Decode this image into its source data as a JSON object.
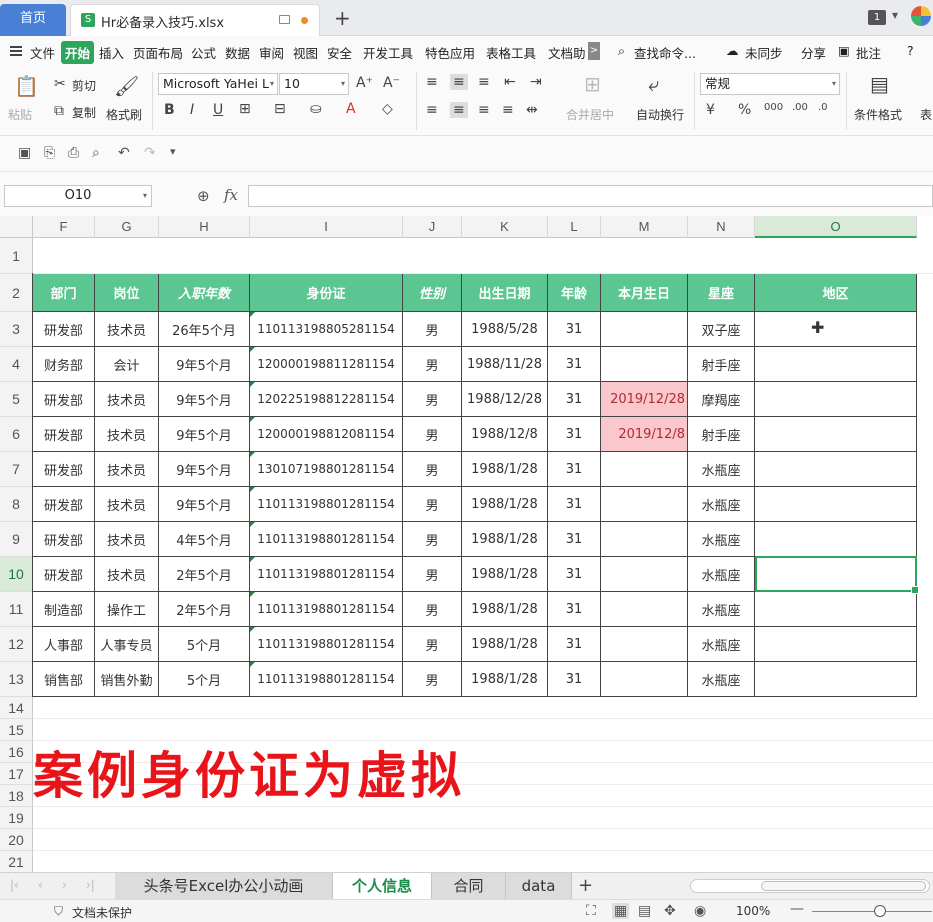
{
  "tabs": {
    "home": "首页",
    "file_badge": "S",
    "file_name": "Hr必备录入技巧.xlsx",
    "window_count": "1"
  },
  "menu": {
    "items": [
      "文件",
      "开始",
      "插入",
      "页面布局",
      "公式",
      "数据",
      "审阅",
      "视图",
      "安全",
      "开发工具",
      "特色应用",
      "表格工具",
      "文档助"
    ],
    "more": ">",
    "search": "查找命令...",
    "sync": "未同步",
    "share": "分享",
    "comment": "批注",
    "help": "?"
  },
  "ribbon": {
    "paste": "粘贴",
    "cut": "剪切",
    "copy": "复制",
    "format_painter": "格式刷",
    "font_name": "Microsoft YaHei L",
    "font_size": "10",
    "merge_center": "合并居中",
    "wrap_text": "自动换行",
    "number_format": "常规",
    "conditional_format": "条件格式",
    "table_style": "表"
  },
  "formula_bar": {
    "name_box": "O10",
    "fx": "fx",
    "content": ""
  },
  "grid": {
    "columns": [
      "F",
      "G",
      "H",
      "I",
      "J",
      "K",
      "L",
      "M",
      "N",
      "O"
    ],
    "selected_column": "O",
    "rows": [
      "1",
      "2",
      "3",
      "4",
      "5",
      "6",
      "7",
      "8",
      "9",
      "10",
      "11",
      "12",
      "13",
      "14",
      "15",
      "16",
      "17",
      "18",
      "19",
      "20",
      "21"
    ],
    "selected_row": "10",
    "header": [
      "部门",
      "岗位",
      "入职年数",
      "身份证",
      "性别",
      "出生日期",
      "年龄",
      "本月生日",
      "星座",
      "地区"
    ],
    "data": [
      [
        "研发部",
        "技术员",
        "26年5个月",
        "110113198805281154",
        "男",
        "1988/5/28",
        "31",
        "",
        "双子座",
        ""
      ],
      [
        "财务部",
        "会计",
        "9年5个月",
        "120000198811281154",
        "男",
        "1988/11/28",
        "31",
        "",
        "射手座",
        ""
      ],
      [
        "研发部",
        "技术员",
        "9年5个月",
        "120225198812281154",
        "男",
        "1988/12/28",
        "31",
        "2019/12/28",
        "摩羯座",
        ""
      ],
      [
        "研发部",
        "技术员",
        "9年5个月",
        "120000198812081154",
        "男",
        "1988/12/8",
        "31",
        "2019/12/8",
        "射手座",
        ""
      ],
      [
        "研发部",
        "技术员",
        "9年5个月",
        "130107198801281154",
        "男",
        "1988/1/28",
        "31",
        "",
        "水瓶座",
        ""
      ],
      [
        "研发部",
        "技术员",
        "9年5个月",
        "110113198801281154",
        "男",
        "1988/1/28",
        "31",
        "",
        "水瓶座",
        ""
      ],
      [
        "研发部",
        "技术员",
        "4年5个月",
        "110113198801281154",
        "男",
        "1988/1/28",
        "31",
        "",
        "水瓶座",
        ""
      ],
      [
        "研发部",
        "技术员",
        "2年5个月",
        "110113198801281154",
        "男",
        "1988/1/28",
        "31",
        "",
        "水瓶座",
        ""
      ],
      [
        "制造部",
        "操作工",
        "2年5个月",
        "110113198801281154",
        "男",
        "1988/1/28",
        "31",
        "",
        "水瓶座",
        ""
      ],
      [
        "人事部",
        "人事专员",
        "5个月",
        "110113198801281154",
        "男",
        "1988/1/28",
        "31",
        "",
        "水瓶座",
        ""
      ],
      [
        "销售部",
        "销售外勤",
        "5个月",
        "110113198801281154",
        "男",
        "1988/1/28",
        "31",
        "",
        "水瓶座",
        ""
      ]
    ],
    "banner": "案例身份证为虚拟",
    "colors": {
      "header_bg": "#5cc692",
      "highlight_bg": "#f9c7cc",
      "highlight_text": "#b22a35",
      "banner": "#e8141a",
      "accent": "#2da55c"
    }
  },
  "sheets": {
    "tabs": [
      "头条号Excel办公小动画",
      "个人信息",
      "合同",
      "data"
    ],
    "active": "个人信息",
    "add": "+"
  },
  "status": {
    "protection": "文档未保护",
    "zoom": "100%"
  }
}
